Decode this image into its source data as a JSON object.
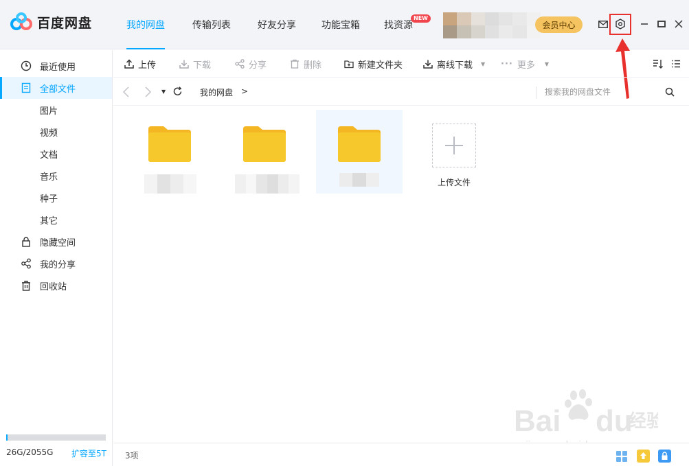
{
  "app": {
    "name": "百度网盘"
  },
  "nav": [
    {
      "label": "我的网盘",
      "active": true
    },
    {
      "label": "传输列表"
    },
    {
      "label": "好友分享"
    },
    {
      "label": "功能宝箱"
    },
    {
      "label": "找资源",
      "badge": "NEW"
    }
  ],
  "header": {
    "vip_label": "会员中心"
  },
  "sidebar": {
    "items": [
      {
        "label": "最近使用",
        "icon": "clock-icon"
      },
      {
        "label": "全部文件",
        "icon": "file-icon",
        "active": true
      },
      {
        "label": "图片"
      },
      {
        "label": "视频"
      },
      {
        "label": "文档"
      },
      {
        "label": "音乐"
      },
      {
        "label": "种子"
      },
      {
        "label": "其它"
      },
      {
        "label": "隐藏空间",
        "icon": "lock-icon"
      },
      {
        "label": "我的分享",
        "icon": "share-icon"
      },
      {
        "label": "回收站",
        "icon": "trash-icon"
      }
    ],
    "quota_text": "26G/2055G",
    "quota_fraction": 0.013,
    "expand_label": "扩容至5T"
  },
  "toolbar": {
    "upload": "上传",
    "download": "下载",
    "share": "分享",
    "delete": "删除",
    "new_folder": "新建文件夹",
    "offline_download": "离线下载",
    "more": "更多"
  },
  "path": {
    "root": "我的网盘",
    "separator": ">",
    "search_placeholder": "搜索我的网盘文件"
  },
  "files": {
    "upload_label": "上传文件"
  },
  "status": {
    "count": "3项"
  },
  "watermark": {
    "brand": "Bai du 经验",
    "url": "jingyan.baidu.com"
  },
  "colors": {
    "accent": "#06a7ff",
    "folder": "#f7c82b",
    "highlight": "#e8312d",
    "vip": "#f5c460"
  }
}
